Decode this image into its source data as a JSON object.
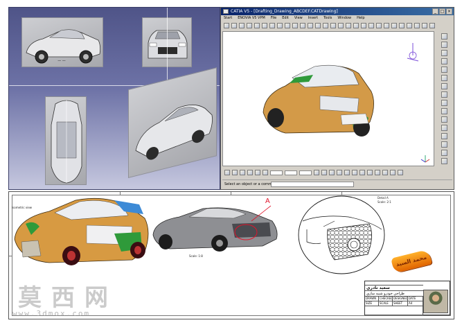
{
  "blueprint": {
    "views": [
      "side-view",
      "front-view",
      "top-view",
      "isometric-view"
    ],
    "background_color": "#5a5f95"
  },
  "catia": {
    "title": "CATIA V5 - [Drafting_Drawing_ABCDEF.CATDrawing]",
    "window_buttons": [
      "_",
      "□",
      "×"
    ],
    "menus": [
      "Start",
      "ENOVIA V5 VPM",
      "File",
      "Edit",
      "View",
      "Insert",
      "Tools",
      "Window",
      "Help"
    ],
    "status_text": "Select an object or a command",
    "accent_color": "#0a246a"
  },
  "sheet": {
    "detail_label": "A",
    "view_captions": [
      "Isometric view",
      "Scale: 1:8"
    ],
    "detail_caption": [
      "Detail A",
      "Scale: 2:1"
    ],
    "stamp_text": "محمد السيد",
    "title_block": {
      "name": "سعيد نادري",
      "project": "طراحي خودرو شبيه سازي",
      "fields": [
        "DRAWN",
        "CHECKED",
        "DESIGNED",
        "DATE",
        "SIZE",
        "SCALE",
        "SHEET",
        "A4"
      ]
    }
  },
  "watermark": {
    "cjk": "莫西网",
    "url": "www.3dmox.com"
  }
}
